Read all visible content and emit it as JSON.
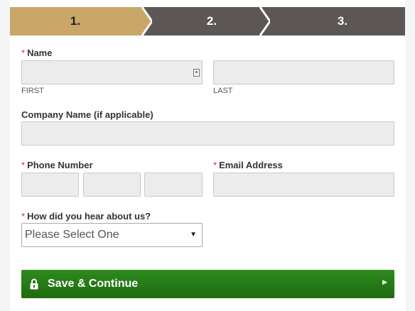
{
  "steps": [
    {
      "label": "1."
    },
    {
      "label": "2."
    },
    {
      "label": "3."
    }
  ],
  "colors": {
    "step_active": "#c8a768",
    "step_inactive": "#5c5654",
    "required_star": "#c0392b",
    "button": "#1e7a14"
  },
  "form": {
    "required_mark": "*",
    "name_label": "Name",
    "first_sublabel": "FIRST",
    "last_sublabel": "LAST",
    "company_label": "Company Name (if applicable)",
    "phone_label": "Phone Number",
    "email_label": "Email Address",
    "hear_label": "How did you hear about us?",
    "hear_select_value": "Please Select One",
    "select_arrow": "▼"
  },
  "button": {
    "label": "Save & Continue",
    "icon": "lock-icon",
    "caret": "▶"
  }
}
